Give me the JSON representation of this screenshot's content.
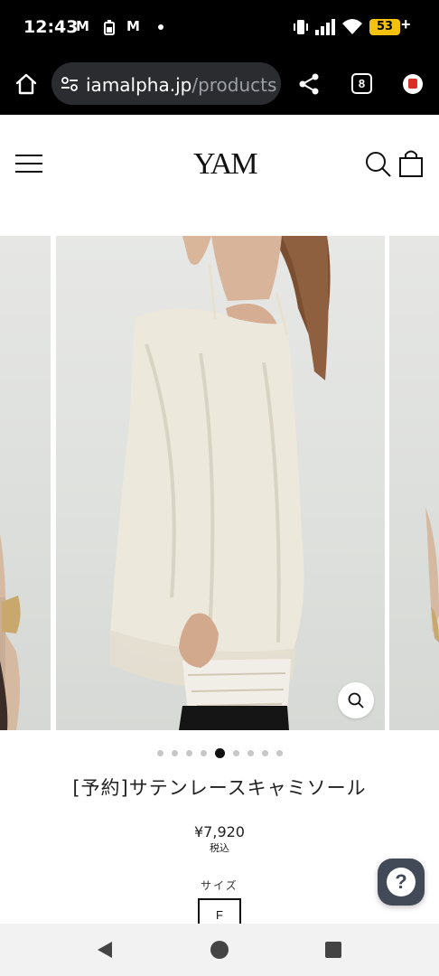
{
  "status_bar": {
    "time": "12:43",
    "notification_icons": [
      "gmail-icon",
      "battery-saver-icon",
      "gmail-icon",
      "dot-icon"
    ],
    "battery_level": "53",
    "battery_plus": "+"
  },
  "browser": {
    "url_domain": "iamalpha.jp",
    "url_path": "/products",
    "tab_count": "8"
  },
  "site": {
    "logo_text": "YAM"
  },
  "gallery": {
    "dot_count": 9,
    "active_index": 4
  },
  "product": {
    "title": "[予約]サテンレースキャミソール",
    "price": "¥7,920",
    "tax_note": "税込",
    "size_label": "サイズ",
    "size_options": [
      "F"
    ]
  },
  "help": {
    "label": "?"
  },
  "colors": {
    "status_bg": "#000000",
    "url_box": "#2b2c30",
    "battery": "#f4c20d",
    "help_button": "#434a57",
    "text": "#222222"
  }
}
